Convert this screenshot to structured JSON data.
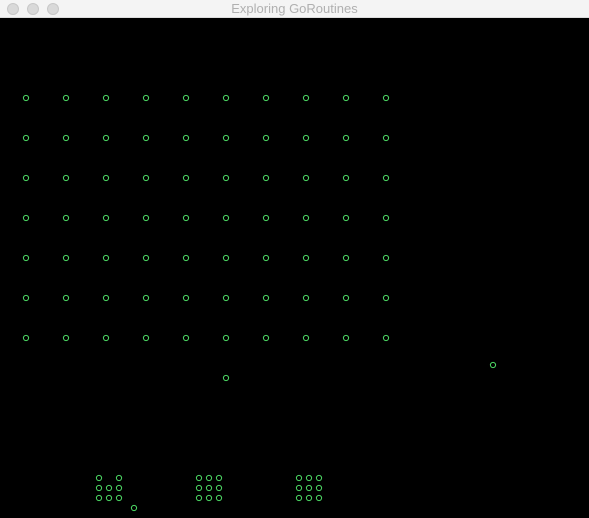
{
  "window": {
    "title": "Exploring GoRoutines"
  },
  "colors": {
    "sprite_stroke": "#4cd964",
    "background": "#000000",
    "titlebar": "#f4f4f4",
    "title_text": "#b0b0b0"
  },
  "game": {
    "invader_grid": {
      "rows": 7,
      "columns": 10,
      "sprite": "hollow-circle"
    },
    "player_sprite": "hollow-circle",
    "bunkers": {
      "count": 3,
      "sprite": "hollow-circle-cluster"
    }
  }
}
